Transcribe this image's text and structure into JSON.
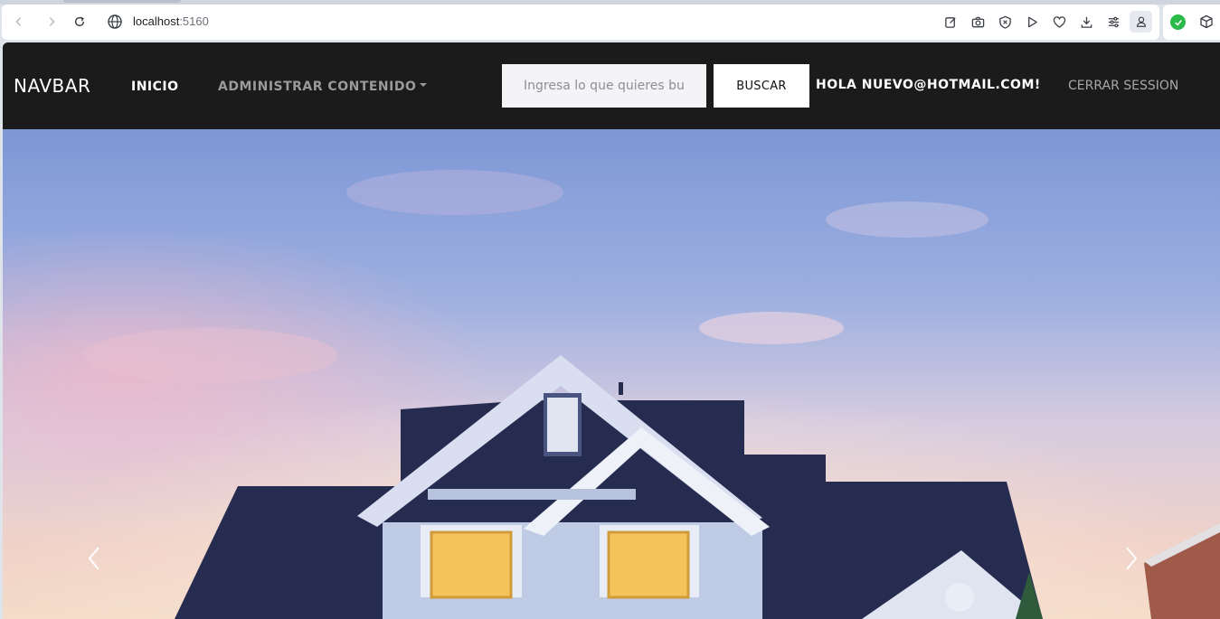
{
  "browser": {
    "url_host": "localhost",
    "url_port": ":5160",
    "icons": [
      "back-icon",
      "forward-icon",
      "reload-icon",
      "globe-icon",
      "edit-icon",
      "camera-icon",
      "shield-icon",
      "play-icon",
      "heart-icon",
      "download-icon",
      "menu-icon",
      "profile-icon",
      "extension-check-icon",
      "extension-cube-icon"
    ]
  },
  "navbar": {
    "brand": "NAVBAR",
    "links": {
      "inicio": "INICIO",
      "admin": "ADMINISTRAR CONTENIDO"
    },
    "search": {
      "placeholder": "Ingresa lo que quieres buscar",
      "button": "BUSCAR"
    },
    "greeting": "HOLA NUEVO@HOTMAIL.COM!",
    "logout": "CERRAR SESSION"
  },
  "carousel": {
    "slide_image": "house-image",
    "prev_icon": "chevron-left-icon",
    "next_icon": "chevron-right-icon"
  },
  "colors": {
    "navbar_bg": "#1b1b1b",
    "sky_top": "#7d97d6",
    "roof": "#262c4f",
    "window_glow": "#f4c35a",
    "extension_green": "#2aba49"
  }
}
